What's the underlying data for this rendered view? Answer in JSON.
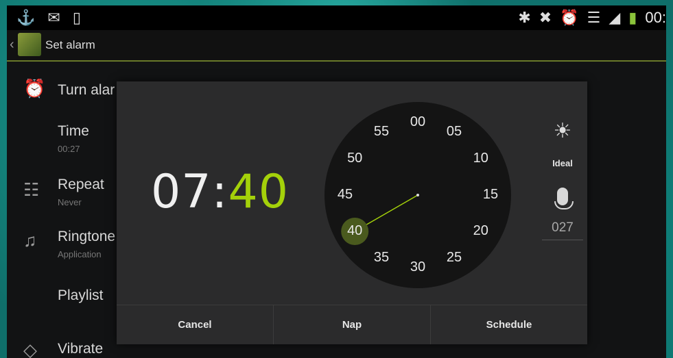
{
  "statusbar": {
    "clock": "00:",
    "left_icons": [
      "usb-icon",
      "mail-icon",
      "phone-icon"
    ],
    "right_icons": [
      "bluetooth-icon",
      "mute-icon",
      "alarm-icon",
      "wifi-icon",
      "signal-icon",
      "battery-icon"
    ]
  },
  "actionbar": {
    "title": "Set alarm"
  },
  "settings": {
    "turn_alarm": "Turn alar",
    "time_label": "Time",
    "time_value": "00:27",
    "repeat_label": "Repeat",
    "repeat_value": "Never",
    "ringtone_label": "Ringtone",
    "ringtone_value": "Application",
    "playlist_label": "Playlist",
    "vibrate_label": "Vibrate"
  },
  "dialog": {
    "hours": "07",
    "separator": ":",
    "minutes": "40",
    "selected_minute": 40,
    "clock_labels": [
      "00",
      "05",
      "10",
      "15",
      "20",
      "25",
      "30",
      "35",
      "40",
      "45",
      "50",
      "55"
    ],
    "side_label": "Ideal",
    "side_code": "027",
    "cancel": "Cancel",
    "nap": "Nap",
    "schedule": "Schedule"
  },
  "colors": {
    "accent": "#a4d10a",
    "dialog_bg": "#2b2b2c",
    "clock_bg": "#141414",
    "selected_bubble": "#4a5a1e"
  }
}
